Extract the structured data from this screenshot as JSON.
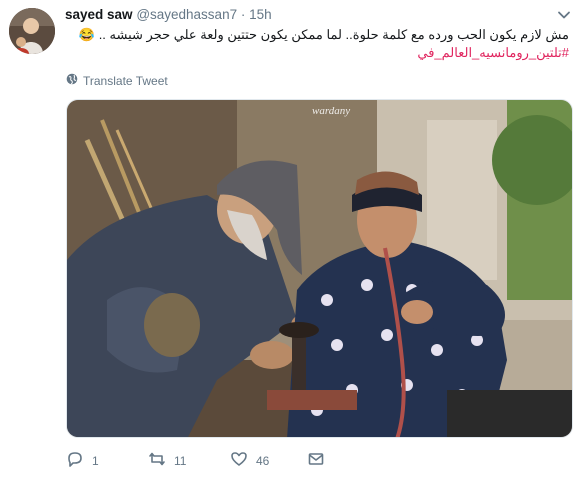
{
  "tweet": {
    "display_name": "sayed saw",
    "handle": "@sayedhassan7",
    "separator": "·",
    "time": "15h",
    "text": "مش لازم يكون الحب ورده مع كلمة حلوة.. لما ممكن يكون حتتين ولعة علي حجر شيشه .. 😂",
    "hashtag": "#تلتين_رومانسيه_العالم_في",
    "translate_label": "Translate Tweet",
    "watermark": "wardany"
  },
  "actions": {
    "replies": "1",
    "retweets": "11",
    "likes": "46"
  },
  "colors": {
    "text": "#14171a",
    "secondary": "#657786",
    "hashtag": "#e0245e",
    "border": "#e1e8ed"
  },
  "icons": [
    "chevron-down-icon",
    "globe-icon",
    "reply-icon",
    "retweet-icon",
    "like-icon",
    "message-icon"
  ]
}
